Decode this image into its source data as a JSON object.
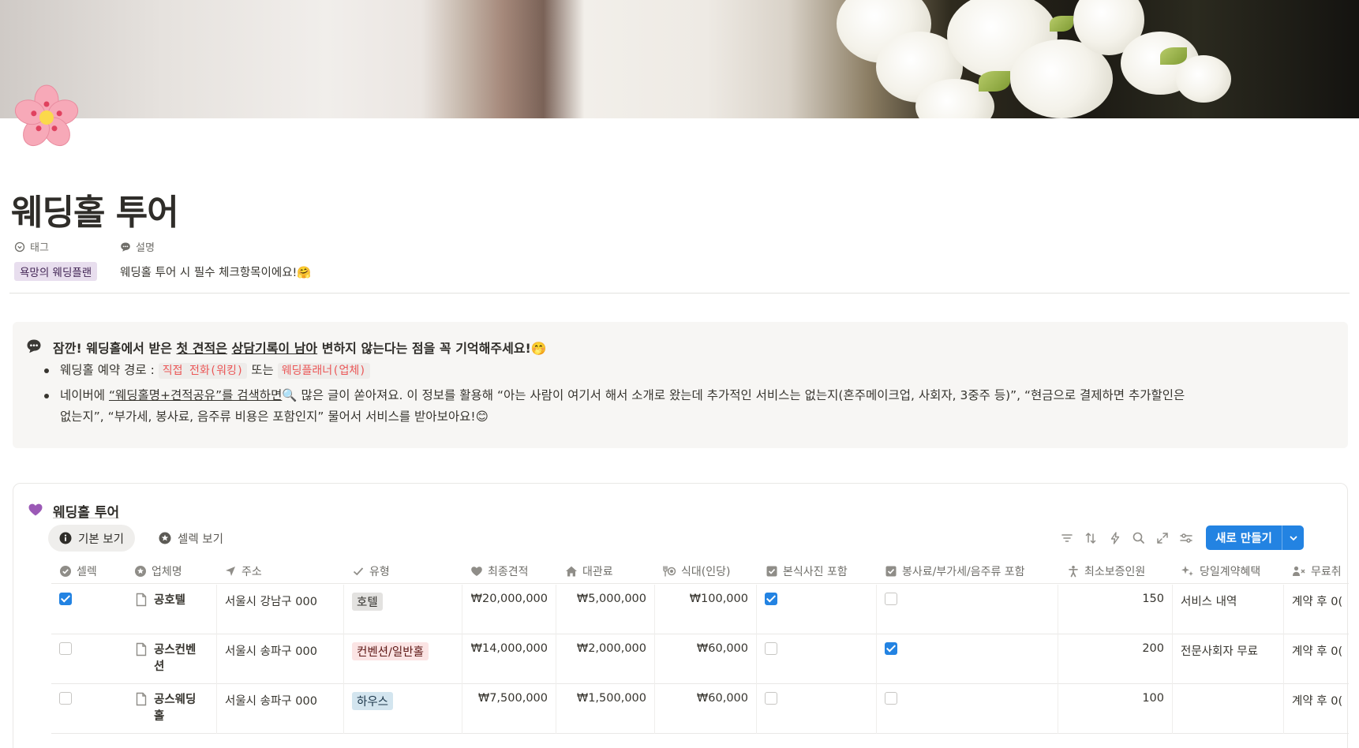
{
  "page": {
    "title": "웨딩홀 투어",
    "icon": "cherry-blossom-icon"
  },
  "properties": {
    "tag_label": "태그",
    "tag_value": "욕망의 웨딩플랜",
    "desc_label": "설명",
    "desc_value": "웨딩홀 투어 시 필수 체크항목이에요!🤗"
  },
  "callout": {
    "icon": "speech-bubble-icon",
    "title_pre": "잠깐! 웨딩홀에서 받은 ",
    "title_u1": "첫 견적은",
    "title_mid": " ",
    "title_u2": "상담기록이 남아",
    "title_post": " 변하지 않는다는 점을 꼭 기억해주세요!🤭",
    "bullet1_pre": "웨딩홀 예약 경로 : ",
    "bullet1_code1": "직접 전화(워킹)",
    "bullet1_mid": " 또는 ",
    "bullet1_code2": "웨딩플래너(업체)",
    "bullet2_pre": "네이버에 ",
    "bullet2_u": "“웨딩홀명+견적공유”를 검색하면",
    "bullet2_line1": "🔍 많은 글이 쏟아져요. 이 정보를 활용해 “아는 사람이 여기서 해서 소개로 왔는데 추가적인 서비스는 없는지(혼주메이크업, 사회자, 3중주 등)”, “현금으로 결제하면 추가할인은",
    "bullet2_line2": "없는지”, “부가세, 봉사료, 음주류 비용은 포함인지” 물어서 서비스를 받아보아요!😊"
  },
  "database": {
    "title": "웨딩홀 투어",
    "icon": "purple-heart-icon",
    "views": [
      {
        "label": "기본 보기",
        "icon": "info-icon",
        "active": true
      },
      {
        "label": "셀렉 보기",
        "icon": "star-icon",
        "active": false
      }
    ],
    "toolbar": {
      "new_button": "새로 만들기"
    },
    "columns": [
      {
        "label": "셀렉",
        "icon": "check-circle-icon"
      },
      {
        "label": "업체명",
        "icon": "star-circle-icon"
      },
      {
        "label": "주소",
        "icon": "location-arrow-icon"
      },
      {
        "label": "유형",
        "icon": "check-icon"
      },
      {
        "label": "최종견적",
        "icon": "heart-icon"
      },
      {
        "label": "대관료",
        "icon": "house-icon"
      },
      {
        "label": "식대(인당)",
        "icon": "utensils-icon"
      },
      {
        "label": "본식사진 포함",
        "icon": "checkbox-icon"
      },
      {
        "label": "봉사료/부가세/음주류 포함",
        "icon": "checkbox-icon"
      },
      {
        "label": "최소보증인원",
        "icon": "person-icon"
      },
      {
        "label": "당일계약혜택",
        "icon": "sparkle-icon"
      },
      {
        "label": "무료취",
        "icon": "person-x-icon"
      }
    ],
    "rows": [
      {
        "select": true,
        "name": "공호텔",
        "address": "서울시 강남구 000",
        "type": "호텔",
        "type_color": "#e3e2e0",
        "type_text_color": "#32302c",
        "final_quote": "₩20,000,000",
        "rental_fee": "₩5,000,000",
        "meal": "₩100,000",
        "photo_included": true,
        "fees_included": false,
        "min_guests": "150",
        "benefit": "서비스 내역",
        "free_cancel": "계약 후 0("
      },
      {
        "select": false,
        "name": "공스컨벤션",
        "address": "서울시 송파구 000",
        "type": "컨벤션/일반홀",
        "type_color": "#fbe4e4",
        "type_text_color": "#5d1715",
        "final_quote": "₩14,000,000",
        "rental_fee": "₩2,000,000",
        "meal": "₩60,000",
        "photo_included": false,
        "fees_included": true,
        "min_guests": "200",
        "benefit": "전문사회자 무료",
        "free_cancel": "계약 후 0("
      },
      {
        "select": false,
        "name": "공스웨딩홀",
        "address": "서울시 송파구 000",
        "type": "하우스",
        "type_color": "#d3e5ef",
        "type_text_color": "#183347",
        "final_quote": "₩7,500,000",
        "rental_fee": "₩1,500,000",
        "meal": "₩60,000",
        "photo_included": false,
        "fees_included": false,
        "min_guests": "100",
        "benefit": "",
        "free_cancel": "계약 후 0("
      }
    ]
  }
}
